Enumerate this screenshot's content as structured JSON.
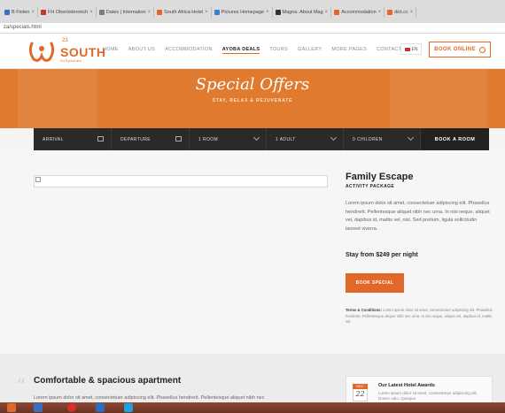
{
  "browser": {
    "tabs": [
      {
        "label": "B Fioten",
        "color": "#3a6fc4"
      },
      {
        "label": "FH Oberösterreich",
        "color": "#c0392b"
      },
      {
        "label": "Dates | Internation",
        "color": "#7d7d7d"
      },
      {
        "label": "South Africa Hotel",
        "color": "#e2682a"
      },
      {
        "label": "Pictures Homepage",
        "color": "#3a7bd5"
      },
      {
        "label": "Magna: About Mag",
        "color": "#333333"
      },
      {
        "label": "Accommodation",
        "color": "#e2682a"
      },
      {
        "label": "dict.cc",
        "color": "#e2682a"
      }
    ],
    "url": "za/specials.html"
  },
  "header": {
    "logo": {
      "number": "23",
      "word": "SOUTH",
      "sub": "SoSpecials"
    },
    "nav": [
      "HOME",
      "ABOUT US",
      "ACCOMMODATION",
      "AYOBA DEALS",
      "TOURS",
      "GALLERY",
      "MORE PAGES",
      "CONTACT"
    ],
    "active_nav": "AYOBA DEALS",
    "language": "EN",
    "book_online": "BOOK ONLINE"
  },
  "hero": {
    "title": "Special Offers",
    "subtitle": "STAY, RELAX & REJUVENATE"
  },
  "booking": {
    "arrival": "ARRIVAL",
    "departure": "DEPARTURE",
    "rooms": "1 ROOM",
    "adults": "1 ADULT",
    "children": "0 CHILDREN",
    "book_button": "BOOK A ROOM"
  },
  "offer": {
    "title": "Family Escape",
    "subtitle": "ACTIVITY PACKAGE",
    "description": "Lorem ipsum dolor sit amet, consectetuer adipiscing elit. Phasellus hendrerit. Pellentesque aliquet nibh nec urna. In nisi neque, aliquet vel, dapibus id, mattis vel, nisi. Sed pretium, ligula sollicitudin laoreet viverra.",
    "price": "Stay from $249 per night",
    "button": "BOOK SPECIAL",
    "terms_label": "Terms & Conditions:",
    "terms_text": "Lorem ipsum dolor sit amet, consectetuer adipiscing elit. Phasellus hendrerit. Pellentesque aliquet nibh nec urna. In nisi neque, aliquet vel, dapibus id, mattis vel."
  },
  "apartment": {
    "title": "Comfortable & spacious apartment",
    "description": "Lorem ipsum dolor sit amet, consectetuer adipiscing elit. Phasellus hendrerit. Pellentesque aliquet nibh nec"
  },
  "award": {
    "month": "DEC",
    "day": "22",
    "title": "Our Latest Hotel Awards",
    "description": "Lorem ipsum dolor sit amet, consectetuer adipiscing elit. Donec odio. Quisque"
  },
  "colors": {
    "accent": "#e2682a",
    "dark": "#2a2a2a"
  }
}
